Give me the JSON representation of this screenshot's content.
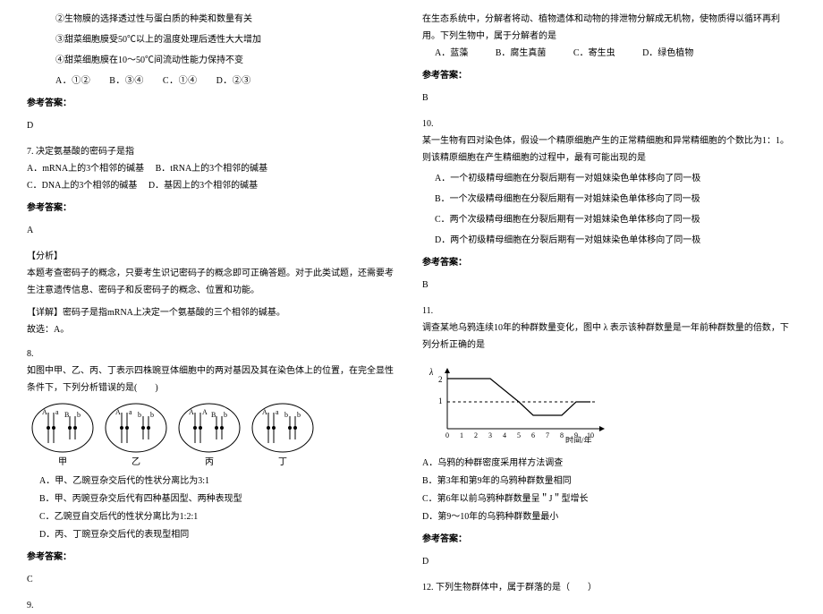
{
  "left": {
    "q6": {
      "s2": "②生物膜的选择透过性与蛋白质的种类和数量有关",
      "s3": "③甜菜细胞膜受50℃以上的温度处理后透性大大增加",
      "s4": "④甜菜细胞膜在10～50℃间流动性能力保持不变",
      "opts": {
        "a": "A．①②",
        "b": "B．③④",
        "c": "C．①④",
        "d": "D．②③"
      },
      "ans_label": "参考答案：",
      "ans": "D"
    },
    "q7": {
      "stem": "7. 决定氨基酸的密码子是指",
      "a": "A．mRNA上的3个相邻的碱基",
      "b": "B．tRNA上的3个相邻的碱基",
      "c": "C．DNA上的3个相邻的碱基",
      "d": "D．基因上的3个相邻的碱基",
      "ans_label": "参考答案：",
      "ans": "A",
      "fx_label": "【分析】",
      "fx_text": "本题考查密码子的概念，只要考生识记密码子的概念即可正确答题。对于此类试题，还需要考生注意遗传信息、密码子和反密码子的概念、位置和功能。",
      "xj_label": "【详解】密码子是指mRNA上决定一个氨基酸的三个相邻的碱基。",
      "conc": "故选：A。"
    },
    "q8": {
      "num": "8.",
      "stem": "如图中甲、乙、丙、丁表示四株豌豆体细胞中的两对基因及其在染色体上的位置，在完全显性条件下，下列分析错误的是(　　)",
      "labels": {
        "a": "甲",
        "b": "乙",
        "c": "丙",
        "d": "丁"
      },
      "gene_a": "A",
      "gene_a2": "a",
      "gene_b": "B",
      "gene_b2": "b",
      "opts": {
        "a": "A．甲、乙豌豆杂交后代的性状分离比为3:1",
        "b": "B．甲、丙豌豆杂交后代有四种基因型、两种表现型",
        "c": "C．乙豌豆自交后代的性状分离比为1:2:1",
        "d": "D．丙、丁豌豆杂交后代的表现型相同"
      },
      "ans_label": "参考答案：",
      "ans": "C"
    },
    "q9": {
      "num": "9."
    }
  },
  "right": {
    "q9": {
      "stem": "在生态系统中，分解者将动、植物遗体和动物的排泄物分解成无机物，使物质得以循环再利用。下列生物中，属于分解者的是",
      "opts": {
        "a": "A．蓝藻",
        "b": "B．腐生真菌",
        "c": "C．寄生虫",
        "d": "D．绿色植物"
      },
      "ans_label": "参考答案：",
      "ans": "B"
    },
    "q10": {
      "num": "10.",
      "stem": "某一生物有四对染色体，假设一个精原细胞产生的正常精细胞和异常精细胞的个数比为1：1。则该精原细胞在产生精细胞的过程中，最有可能出现的是",
      "a": "A．一个初级精母细胞在分裂后期有一对姐妹染色单体移向了同一极",
      "b": "B．一个次级精母细胞在分裂后期有一对姐妹染色单体移向了同一极",
      "c": "C．两个次级精母细胞在分裂后期有一对姐妹染色单体移向了同一极",
      "d": "D．两个初级精母细胞在分裂后期有一对姐妹染色单体移向了同一极",
      "ans_label": "参考答案：",
      "ans": "B"
    },
    "q11": {
      "num": "11.",
      "stem": "调查某地乌鸦连续10年的种群数量变化，图中 λ 表示该种群数量是一年前种群数量的倍数，下列分析正确的是",
      "axis_y": "λ",
      "axis_x": "时间/年",
      "ticks_x": [
        "0",
        "1",
        "2",
        "3",
        "4",
        "5",
        "6",
        "7",
        "8",
        "9",
        "10"
      ],
      "ticks_y_1": "1",
      "ticks_y_2": "2",
      "opts": {
        "a": "A．乌鸦的种群密度采用样方法调查",
        "b": "B．第3年和第9年的乌鸦种群数量相同",
        "c": "C．第6年以前乌鸦种群数量呈＂J＂型增长",
        "d": "D．第9～10年的乌鸦种群数量最小"
      },
      "ans_label": "参考答案：",
      "ans": "D"
    },
    "q12": {
      "stem": "12. 下列生物群体中，属于群落的是（　　）"
    }
  },
  "chart_data": {
    "type": "line",
    "title": "",
    "xlabel": "时间/年",
    "ylabel": "λ",
    "x": [
      0,
      1,
      2,
      3,
      4,
      5,
      6,
      7,
      8,
      9,
      10
    ],
    "values": [
      2,
      2,
      2,
      2,
      1.5,
      1.0,
      0.5,
      0.5,
      0.5,
      1.0,
      1.0
    ],
    "ylim": [
      0,
      2.2
    ],
    "xlim": [
      0,
      10
    ],
    "reference_line": 1
  }
}
